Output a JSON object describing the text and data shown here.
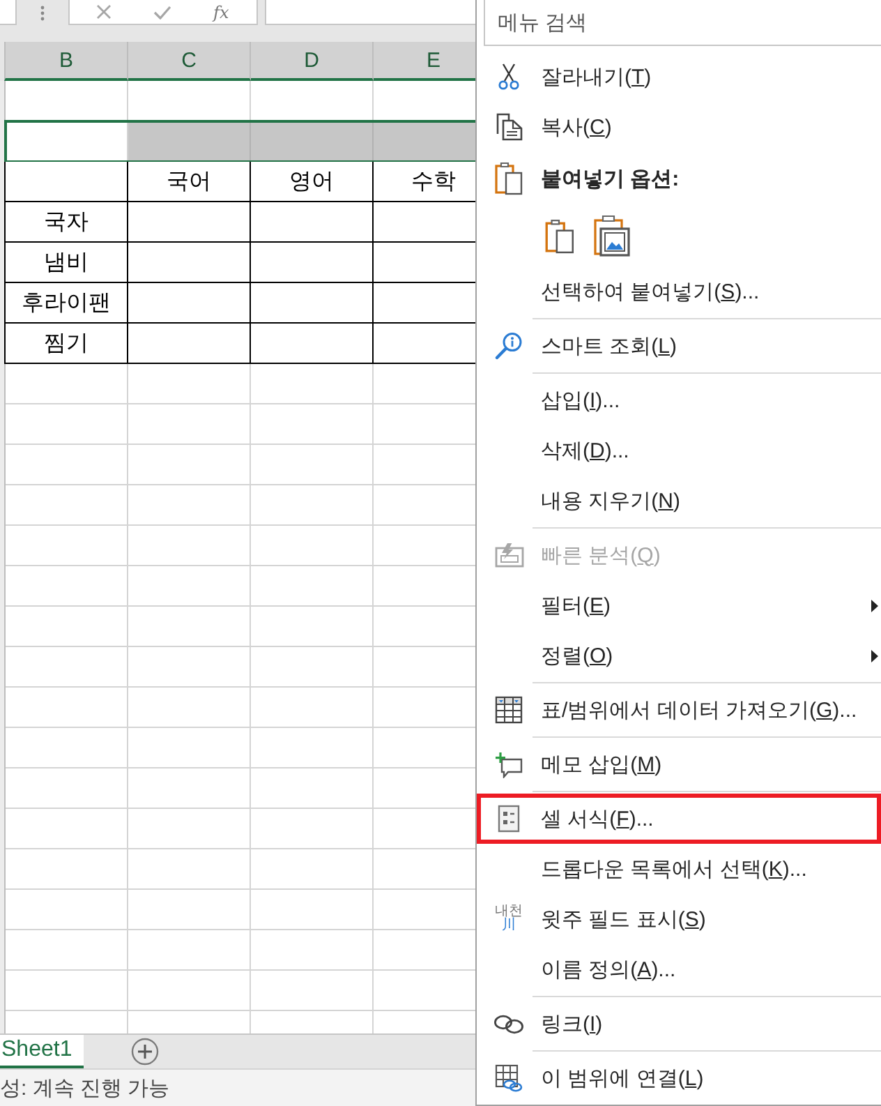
{
  "formula_bar": {
    "function_button": "fx"
  },
  "columns": [
    {
      "label": "B",
      "selected": true
    },
    {
      "label": "C",
      "selected": true
    },
    {
      "label": "D",
      "selected": true
    },
    {
      "label": "E",
      "selected": true
    }
  ],
  "rows": [
    {
      "selected": false,
      "bordered": false
    },
    {
      "selected": true,
      "bordered": false
    },
    {
      "selected": false,
      "bordered": true,
      "headings": [
        "국어",
        "영어",
        "수학"
      ]
    },
    {
      "selected": false,
      "bordered": true,
      "label": "국자"
    },
    {
      "selected": false,
      "bordered": true,
      "label": "냄비"
    },
    {
      "selected": false,
      "bordered": true,
      "label": "후라이팬"
    },
    {
      "selected": false,
      "bordered": true,
      "label": "찜기"
    }
  ],
  "sheet_tabs": [
    {
      "label": "Sheet1",
      "selected": true
    }
  ],
  "status_bar": {
    "text": "성: 계속 진행 가능"
  },
  "context_menu": {
    "search": {
      "placeholder": "메뉴 검색"
    },
    "sections": [
      {
        "items": [
          {
            "kind": "cut",
            "label": "잘라내기(",
            "access_key": "T",
            "label_end": ")",
            "disabled": false,
            "submenu": false,
            "highlighted": false
          },
          {
            "kind": "copy",
            "label": "복사(",
            "access_key": "C",
            "label_end": ")",
            "disabled": false,
            "submenu": false,
            "highlighted": false
          },
          {
            "kind": "pasteheading",
            "label": "붙여넣기 옵션:",
            "options": [
              {
                "kind": "paste"
              },
              {
                "kind": "picture"
              }
            ]
          },
          {
            "kind": "plain",
            "label": "선택하여 붙여넣기(",
            "access_key": "S",
            "label_end": ")...",
            "disabled": false,
            "submenu": false,
            "highlighted": false
          }
        ]
      },
      {
        "items": [
          {
            "kind": "lookup",
            "label": "스마트 조회(",
            "access_key": "L",
            "label_end": ")",
            "disabled": false,
            "submenu": false,
            "highlighted": false
          }
        ]
      },
      {
        "items": [
          {
            "kind": "plain",
            "label": "삽입(",
            "access_key": "I",
            "label_end": ")...",
            "disabled": false,
            "submenu": false,
            "highlighted": false
          },
          {
            "kind": "plain",
            "label": "삭제(",
            "access_key": "D",
            "label_end": ")...",
            "disabled": false,
            "submenu": false,
            "highlighted": false
          },
          {
            "kind": "plain",
            "label": "내용 지우기(",
            "access_key": "N",
            "label_end": ")",
            "disabled": false,
            "submenu": false,
            "highlighted": false
          }
        ]
      },
      {
        "items": [
          {
            "kind": "analysis",
            "label": "빠른 분석(",
            "access_key": "Q",
            "label_end": ")",
            "disabled": true,
            "submenu": false,
            "highlighted": false
          },
          {
            "kind": "plain",
            "label": "필터(",
            "access_key": "E",
            "label_end": ")",
            "disabled": false,
            "submenu": true,
            "highlighted": false
          },
          {
            "kind": "plain",
            "label": "정렬(",
            "access_key": "O",
            "label_end": ")",
            "disabled": false,
            "submenu": true,
            "highlighted": false
          }
        ]
      },
      {
        "items": [
          {
            "kind": "table",
            "label": "표/범위에서 데이터 가져오기(",
            "access_key": "G",
            "label_end": ")...",
            "disabled": false,
            "submenu": false,
            "highlighted": false
          }
        ]
      },
      {
        "items": [
          {
            "kind": "note",
            "label": "메모 삽입(",
            "access_key": "M",
            "label_end": ")",
            "disabled": false,
            "submenu": false,
            "highlighted": false
          }
        ]
      },
      {
        "items": [
          {
            "kind": "format",
            "label": "셀 서식(",
            "access_key": "F",
            "label_end": ")...",
            "disabled": false,
            "submenu": false,
            "highlighted": true
          },
          {
            "kind": "plain",
            "label": "드롭다운 목록에서 선택(",
            "access_key": "K",
            "label_end": ")...",
            "disabled": false,
            "submenu": false,
            "highlighted": false
          },
          {
            "kind": "phonetic",
            "icon_text": [
              "내천",
              "川"
            ],
            "label": "윗주 필드 표시(",
            "access_key": "S",
            "label_end": ")",
            "disabled": false,
            "submenu": false,
            "highlighted": false
          },
          {
            "kind": "plain",
            "label": "이름 정의(",
            "access_key": "A",
            "label_end": ")...",
            "disabled": false,
            "submenu": false,
            "highlighted": false
          }
        ]
      },
      {
        "items": [
          {
            "kind": "link",
            "label": "링크(",
            "access_key": "I",
            "label_end": ")",
            "disabled": false,
            "submenu": false,
            "highlighted": false
          }
        ]
      },
      {
        "items": [
          {
            "kind": "connect",
            "label": "이 범위에 연결(",
            "access_key": "L",
            "label_end": ")",
            "disabled": false,
            "submenu": false,
            "highlighted": false
          }
        ]
      }
    ]
  }
}
